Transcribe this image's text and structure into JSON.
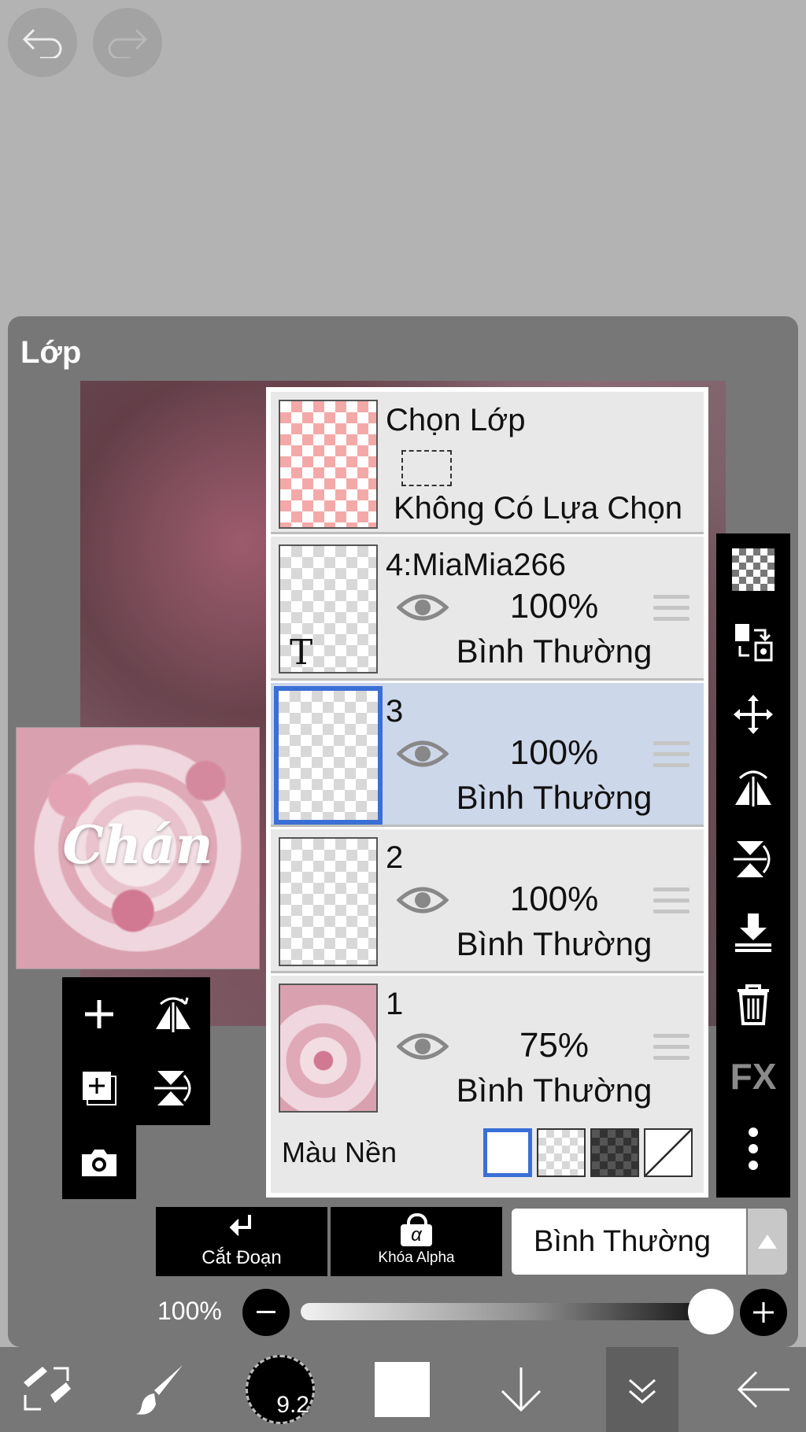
{
  "top": {
    "undo_icon": "undo-icon",
    "redo_icon": "redo-icon"
  },
  "panel": {
    "title": "Lớp"
  },
  "selection_layer": {
    "name": "Chọn Lớp",
    "status": "Không Có Lựa Chọn"
  },
  "layers": [
    {
      "name": "4:MiaMia266",
      "opacity": "100%",
      "blend": "Bình Thường",
      "thumb_text": "T"
    },
    {
      "name": "3",
      "opacity": "100%",
      "blend": "Bình Thường",
      "selected": true
    },
    {
      "name": "2",
      "opacity": "100%",
      "blend": "Bình Thường"
    },
    {
      "name": "1",
      "opacity": "75%",
      "blend": "Bình Thường"
    }
  ],
  "background_color": {
    "label": "Màu Nền"
  },
  "preview": {
    "text": "Chán"
  },
  "right_tools": {
    "fx_label": "FX"
  },
  "actions": {
    "clip_label": "Cắt Đoạn",
    "alpha_lock_label": "Khóa Alpha",
    "alpha_symbol": "α",
    "blend_mode": "Bình Thường"
  },
  "opacity_slider": {
    "label": "100%",
    "value": 1.0
  },
  "bottom": {
    "brush_size": "9.2"
  },
  "colors": {
    "selected_row": "#cdd7ea",
    "accent": "#3a6fd6",
    "panel": "#777777"
  }
}
